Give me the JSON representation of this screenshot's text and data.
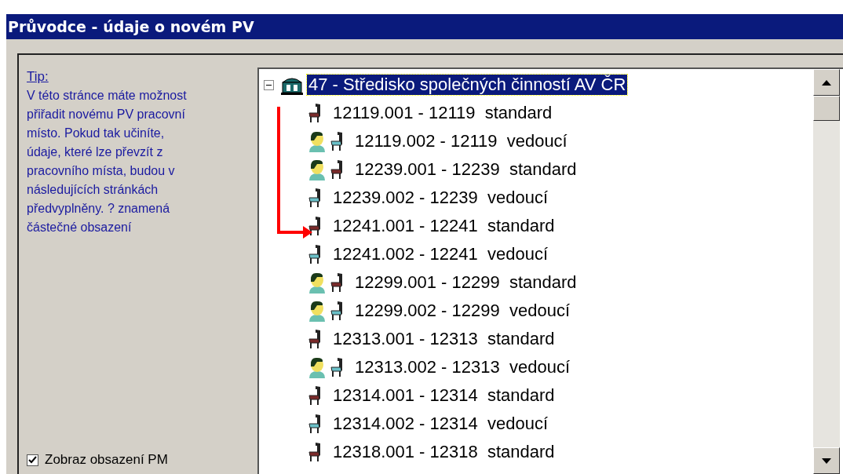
{
  "window": {
    "title": "Průvodce - údaje o novém PV"
  },
  "tip": {
    "heading": "Tip:",
    "text": "V této stránce máte možnost přiřadit novému PV pracovní místo. Pokud tak učiníte, údaje, které lze převzít z pracovního místa, budou v následujících stránkách předvyplněny. ? znamená částečné obsazení"
  },
  "checkbox": {
    "label": "Zobraz obsazení PM",
    "checked": true
  },
  "tree": {
    "root": {
      "label": "47 - Středisko společných činností AV ČR",
      "expanded": true,
      "selected": true,
      "children": [
        {
          "label": "12119.001 - 12119  standard",
          "kind": "standard",
          "occupied": false
        },
        {
          "label": "12119.002 - 12119  vedoucí",
          "kind": "lead",
          "occupied": true
        },
        {
          "label": "12239.001 - 12239  standard",
          "kind": "standard",
          "occupied": true
        },
        {
          "label": "12239.002 - 12239  vedoucí",
          "kind": "lead",
          "occupied": false
        },
        {
          "label": "12241.001 - 12241  standard",
          "kind": "standard",
          "occupied": false
        },
        {
          "label": "12241.002 - 12241  vedoucí",
          "kind": "lead",
          "occupied": false
        },
        {
          "label": "12299.001 - 12299  standard",
          "kind": "standard",
          "occupied": true
        },
        {
          "label": "12299.002 - 12299  vedoucí",
          "kind": "lead",
          "occupied": true
        },
        {
          "label": "12313.001 - 12313  standard",
          "kind": "standard",
          "occupied": false
        },
        {
          "label": "12313.002 - 12313  vedoucí",
          "kind": "lead",
          "occupied": true
        },
        {
          "label": "12314.001 - 12314  standard",
          "kind": "standard",
          "occupied": false
        },
        {
          "label": "12314.002 - 12314  vedoucí",
          "kind": "lead",
          "occupied": false
        },
        {
          "label": "12318.001 - 12318  standard",
          "kind": "standard",
          "occupied": false
        }
      ]
    }
  }
}
